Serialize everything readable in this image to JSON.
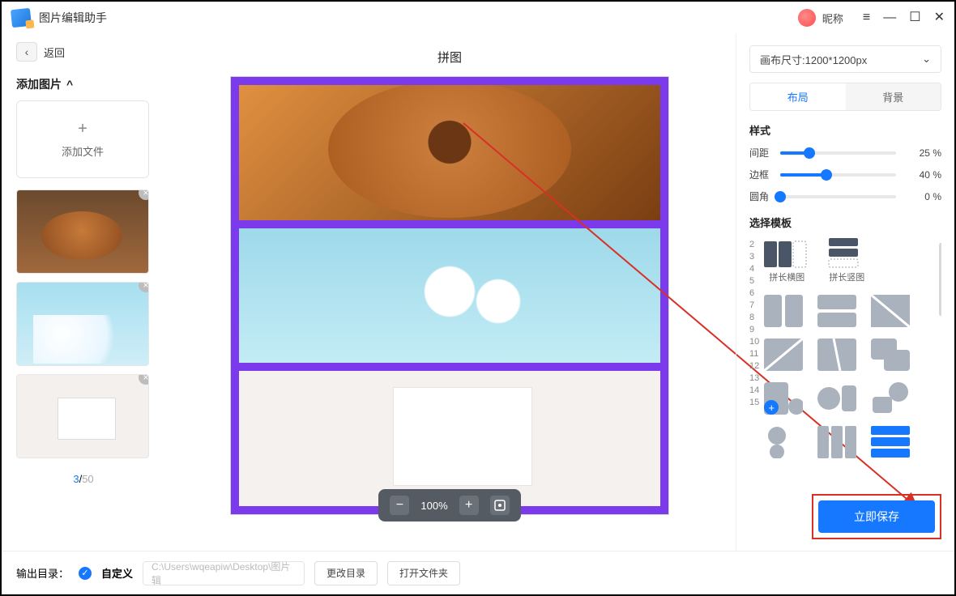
{
  "titlebar": {
    "title": "图片编辑助手",
    "nickname": "昵称"
  },
  "back_label": "返回",
  "add_section": {
    "title": "添加图片",
    "caret": "^",
    "add_file": "添加文件"
  },
  "counter": {
    "current": "3",
    "separator": "/",
    "total": "50"
  },
  "page_title": "拼图",
  "zoom": {
    "value": "100%"
  },
  "right": {
    "canvas_size": "画布尺寸:1200*1200px",
    "tabs": {
      "layout": "布局",
      "background": "背景"
    },
    "style_title": "样式",
    "sliders": {
      "spacing": {
        "label": "间距",
        "value": "25",
        "unit": "%"
      },
      "border": {
        "label": "边框",
        "value": "40",
        "unit": "%"
      },
      "radius": {
        "label": "圆角",
        "value": "0",
        "unit": "%"
      }
    },
    "template_title": "选择模板",
    "template_labels": {
      "hlong": "拼长横图",
      "vlong": "拼长竖图"
    },
    "numbers": [
      "2",
      "3",
      "4",
      "5",
      "6",
      "7",
      "8",
      "9",
      "10",
      "11",
      "12",
      "13",
      "14",
      "15"
    ]
  },
  "save_label": "立即保存",
  "bottom": {
    "output_label": "输出目录：",
    "custom_label": "自定义",
    "path_placeholder": "C:\\Users\\wqeapiw\\Desktop\\图片辑",
    "change_dir": "更改目录",
    "open_folder": "打开文件夹"
  }
}
